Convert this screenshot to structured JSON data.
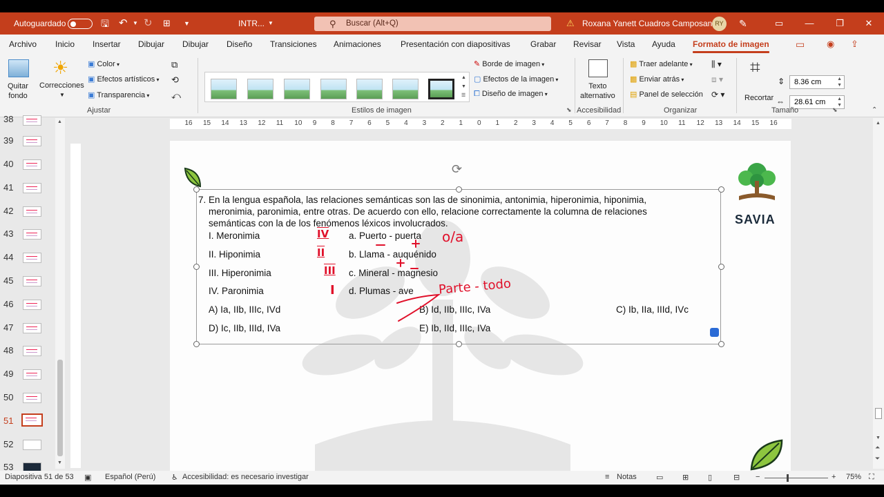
{
  "titlebar": {
    "autosave_label": "Autoguardado",
    "filename": "INTR...",
    "search_placeholder": "Buscar (Alt+Q)",
    "user_name": "Roxana Yanett Cuadros Camposano",
    "user_initials": "RY"
  },
  "tabs": [
    "Archivo",
    "Inicio",
    "Insertar",
    "Dibujar",
    "Dibujar",
    "Diseño",
    "Transiciones",
    "Animaciones",
    "Presentación con diapositivas",
    "Grabar",
    "Revisar",
    "Vista",
    "Ayuda",
    "Formato de imagen"
  ],
  "ribbon": {
    "quitar_fondo": [
      "Quitar",
      "fondo"
    ],
    "correcciones": "Correcciones",
    "color": "Color",
    "efectos_artisticos": "Efectos artísticos",
    "transparencia": "Transparencia",
    "group_ajustar": "Ajustar",
    "group_estilos": "Estilos de imagen",
    "borde_imagen": "Borde de imagen",
    "efectos_imagen": "Efectos de la imagen",
    "diseno_imagen": "Diseño de imagen",
    "texto_alternativo": [
      "Texto",
      "alternativo"
    ],
    "group_accesibilidad": "Accesibilidad",
    "traer_adelante": "Traer adelante",
    "enviar_atras": "Enviar atrás",
    "panel_seleccion": "Panel de selección",
    "group_organizar": "Organizar",
    "recortar": "Recortar",
    "height": "8.36 cm",
    "width": "28.61 cm",
    "group_tamano": "Tamaño"
  },
  "slides": {
    "numbers": [
      "38",
      "39",
      "40",
      "41",
      "42",
      "43",
      "44",
      "45",
      "46",
      "47",
      "48",
      "49",
      "50",
      "51",
      "52",
      "53"
    ],
    "active": "51"
  },
  "ruler": [
    "16",
    "15",
    "14",
    "13",
    "12",
    "11",
    "10",
    "9",
    "8",
    "7",
    "6",
    "5",
    "4",
    "3",
    "2",
    "1",
    "0",
    "1",
    "2",
    "3",
    "4",
    "5",
    "6",
    "7",
    "8",
    "9",
    "10",
    "11",
    "12",
    "13",
    "14",
    "15",
    "16"
  ],
  "slide": {
    "brand": "SAVIA",
    "question_lines": [
      "7. En la lengua española, las relaciones semánticas son las de sinonimia, antonimia, hiperonimia, hiponimia,",
      "meronimia, paronimia, entre otras. De acuerdo con ello, relacione correctamente la columna de relaciones",
      "semánticas con la de los fenómenos léxicos involucrados."
    ],
    "left_column": [
      "I. Meronimia",
      "II. Hiponimia",
      "III. Hiperonimia",
      "IV. Paronimia"
    ],
    "right_column": [
      "a. Puerto - puerta",
      "b. Llama - auquénido",
      "c. Mineral - magnesio",
      "d. Plumas - ave"
    ],
    "options": {
      "a": "A) Ia, IIb, IIIc, IVd",
      "b": "B) Id, IIb, IIIc, IVa",
      "c": "C) Ib, IIa, IIId, IVc",
      "d": "D) Ic, IIb, IIId, IVa",
      "e": "E) Ib, IId, IIIc, IVa"
    },
    "annotations": {
      "mark_1": "IV",
      "mark_2": "II",
      "mark_3": "III",
      "mark_4": "I",
      "note_1": "o/a",
      "note_2": "Parte - todo"
    }
  },
  "statusbar": {
    "slide_info": "Diapositiva 51 de 53",
    "language": "Español (Perú)",
    "accessibility": "Accesibilidad: es necesario investigar",
    "notes": "Notas",
    "zoom": "75%"
  }
}
